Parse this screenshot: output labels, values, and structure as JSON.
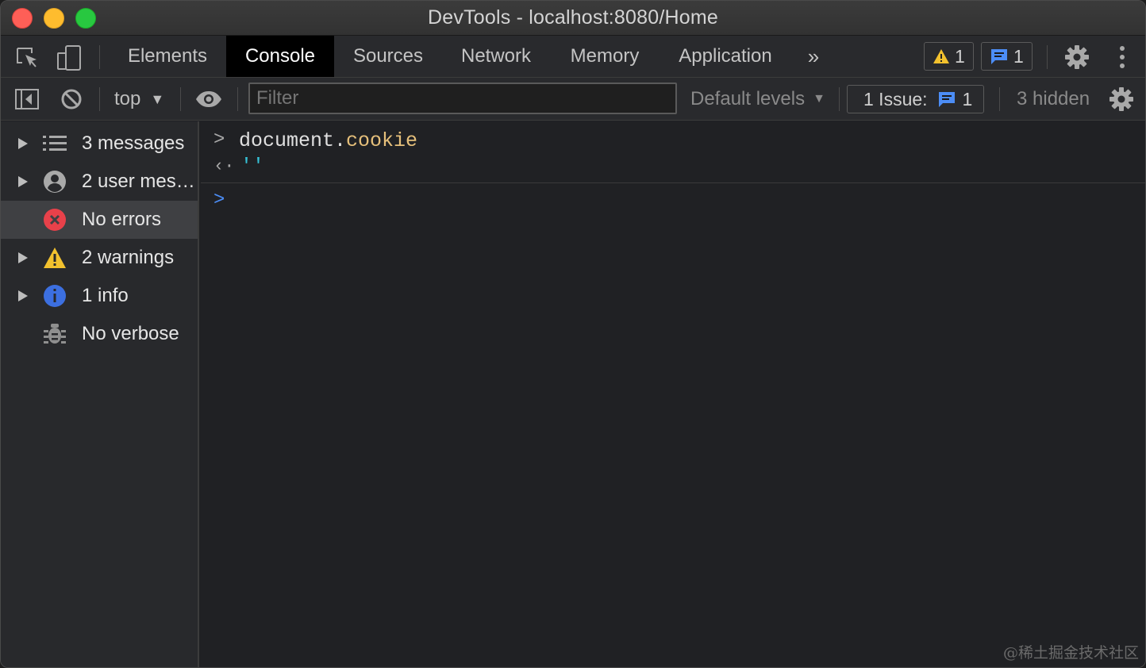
{
  "window": {
    "title": "DevTools - localhost:8080/Home"
  },
  "tabs": [
    {
      "label": "Elements"
    },
    {
      "label": "Console",
      "active": true
    },
    {
      "label": "Sources"
    },
    {
      "label": "Network"
    },
    {
      "label": "Memory"
    },
    {
      "label": "Application"
    }
  ],
  "badges": {
    "warnings": "1",
    "messages": "1"
  },
  "toolbar": {
    "context": "top",
    "filter_placeholder": "Filter",
    "levels": "Default levels",
    "issues_label": "1 Issue:",
    "issues_count": "1",
    "hidden": "3 hidden"
  },
  "sidebar": {
    "items": [
      {
        "label": "3 messages",
        "icon": "list-icon",
        "expandable": true
      },
      {
        "label": "2 user mes…",
        "icon": "user-icon",
        "expandable": true
      },
      {
        "label": "No errors",
        "icon": "error-icon",
        "expandable": false,
        "selected": true
      },
      {
        "label": "2 warnings",
        "icon": "warning-icon",
        "expandable": true
      },
      {
        "label": "1 info",
        "icon": "info-icon",
        "expandable": true
      },
      {
        "label": "No verbose",
        "icon": "bug-icon",
        "expandable": false
      }
    ]
  },
  "console": {
    "input_object": "document",
    "input_dot": ".",
    "input_property": "cookie",
    "result": "''"
  },
  "watermark": "@稀土掘金技术社区",
  "colors": {
    "accent_blue": "#4c8df6",
    "warning_yellow": "#f2c12e",
    "error_red": "#e8414a",
    "property_yellow": "#e6c07b",
    "string_cyan": "#36c1d6"
  }
}
